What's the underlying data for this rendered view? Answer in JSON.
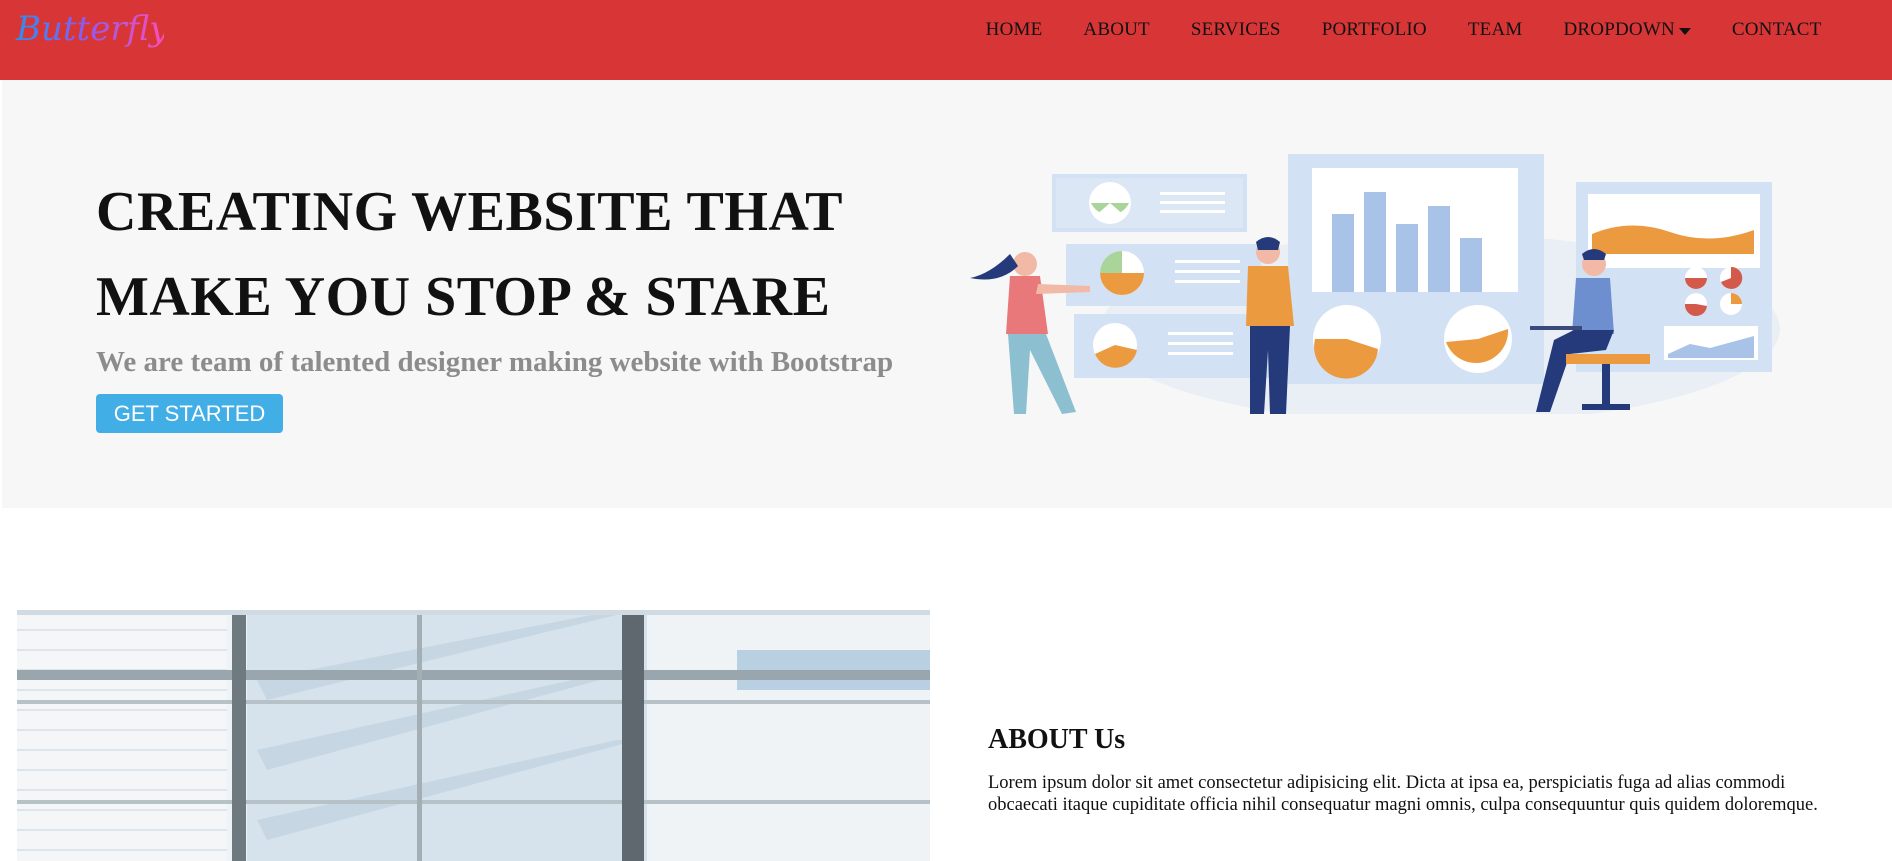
{
  "brand": {
    "logo_text": "Butterfly"
  },
  "nav": {
    "items": [
      {
        "label": "HOME"
      },
      {
        "label": "ABOUT"
      },
      {
        "label": "SERVICES"
      },
      {
        "label": "PORTFOLIO"
      },
      {
        "label": "TEAM"
      },
      {
        "label": "DROPDOWN",
        "has_caret": true
      },
      {
        "label": "CONTACT"
      }
    ]
  },
  "hero": {
    "title_line1": "CREATING WEBSITE THAT",
    "title_line2": "MAKE YOU STOP & STARE",
    "subtitle": "We are team of talented designer making website with Bootstrap",
    "cta_label": "GET STARTED"
  },
  "about": {
    "title": "ABOUT Us",
    "text_line1": "Lorem ipsum dolor sit amet consectetur adipisicing elit. Dicta at ipsa ea, perspiciatis fuga ad alias commodi",
    "text_line2": "obcaecati itaque cupiditate officia nihil consequatur magni omnis, culpa consequuntur quis quidem doloremque."
  },
  "colors": {
    "navbar_bg": "#d83636",
    "hero_bg": "#f7f7f7",
    "cta_bg": "#42aee6",
    "subtitle_gray": "#8c8c8c",
    "illus_blue": "#a9c2e8",
    "illus_orange": "#ec9a3f"
  },
  "icons": {
    "dropdown": "caret-down-icon",
    "illustration": "business-analytics-illustration",
    "about_image": "office-window-photo"
  }
}
